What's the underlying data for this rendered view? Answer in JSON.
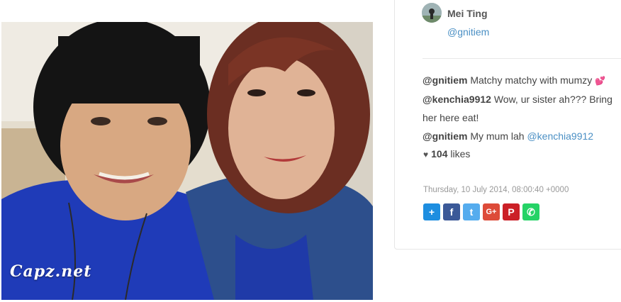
{
  "post": {
    "watermark": "Capz.net",
    "author": {
      "name": "Mei Ting",
      "handle": "@gnitiem"
    },
    "comments": [
      {
        "user": "@gnitiem",
        "text": " Matchy matchy with mumzy ",
        "emoji": "💕"
      },
      {
        "user": "@kenchia9912",
        "text": " Wow, ur sister ah??? Bring her here eat!"
      },
      {
        "user": "@gnitiem",
        "text": " My mum lah ",
        "mention": "@kenchia9912"
      }
    ],
    "likes": {
      "count": "104",
      "label": " likes"
    },
    "timestamp": "Thursday, 10 July 2014, 08:00:40 +0000"
  },
  "share": [
    {
      "icon": "addthis-plus-icon",
      "symbol": "+",
      "color": "#1e8ee0"
    },
    {
      "icon": "facebook-icon",
      "symbol": "f",
      "color": "#3b5998"
    },
    {
      "icon": "twitter-icon",
      "symbol": "t",
      "color": "#55acee"
    },
    {
      "icon": "google-plus-icon",
      "symbol": "G+",
      "color": "#dd4b39"
    },
    {
      "icon": "pinterest-icon",
      "symbol": "P",
      "color": "#cb2027"
    },
    {
      "icon": "whatsapp-icon",
      "symbol": "✆",
      "color": "#25d366"
    }
  ]
}
